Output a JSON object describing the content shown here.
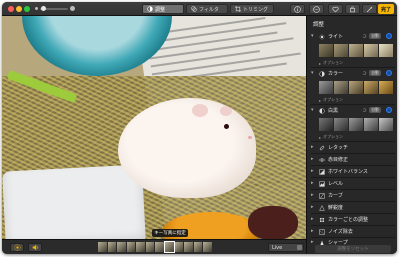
{
  "window": {
    "controls": [
      "close",
      "minimize",
      "zoom"
    ]
  },
  "toolbar": {
    "zoom_slider": {
      "level": 0.05
    },
    "tabs": [
      {
        "label": "調整",
        "icon": "adjust-icon",
        "active": true
      },
      {
        "label": "フィルタ",
        "icon": "filter-icon",
        "active": false
      },
      {
        "label": "トリミング",
        "icon": "crop-icon",
        "active": false
      }
    ],
    "right_buttons": [
      {
        "icon": "info-icon"
      },
      {
        "icon": "more-icon"
      },
      {
        "icon": "heart-icon"
      },
      {
        "icon": "rotate-icon"
      },
      {
        "icon": "magic-wand-icon"
      }
    ],
    "done_label": "完了",
    "accent_color": "#f5b400"
  },
  "photo": {
    "tooltip": "キー写真に指定"
  },
  "bottom_bar": {
    "left_buttons": [
      {
        "icon": "live-photo-icon"
      },
      {
        "icon": "speaker-icon"
      }
    ],
    "filmstrip_frames": 12,
    "selected_frame": 7,
    "live_select": "Live"
  },
  "panel": {
    "title": "調整",
    "options_label": "オプション",
    "sections": [
      {
        "label": "ライト",
        "icon": "sun-icon",
        "expanded": true,
        "auto": "自動"
      },
      {
        "label": "カラー",
        "icon": "color-circle-icon",
        "expanded": true,
        "auto": "自動"
      },
      {
        "label": "白黒",
        "icon": "bw-circle-icon",
        "expanded": true,
        "auto": "自動"
      }
    ],
    "tools": [
      {
        "label": "レタッチ",
        "icon": "bandage-icon"
      },
      {
        "label": "赤目修正",
        "icon": "eye-icon"
      },
      {
        "label": "ホワイトバランス",
        "icon": "wb-icon"
      },
      {
        "label": "レベル",
        "icon": "levels-icon"
      },
      {
        "label": "カーブ",
        "icon": "curves-icon"
      },
      {
        "label": "鮮鋭度",
        "icon": "triangle-icon"
      },
      {
        "label": "カラーごとの調整",
        "icon": "color-dots-icon"
      },
      {
        "label": "ノイズ除去",
        "icon": "noise-icon"
      },
      {
        "label": "シャープ",
        "icon": "sharpen-icon"
      }
    ],
    "reset_label": "調整をリセット",
    "toggle_color": "#2d7ff9"
  }
}
